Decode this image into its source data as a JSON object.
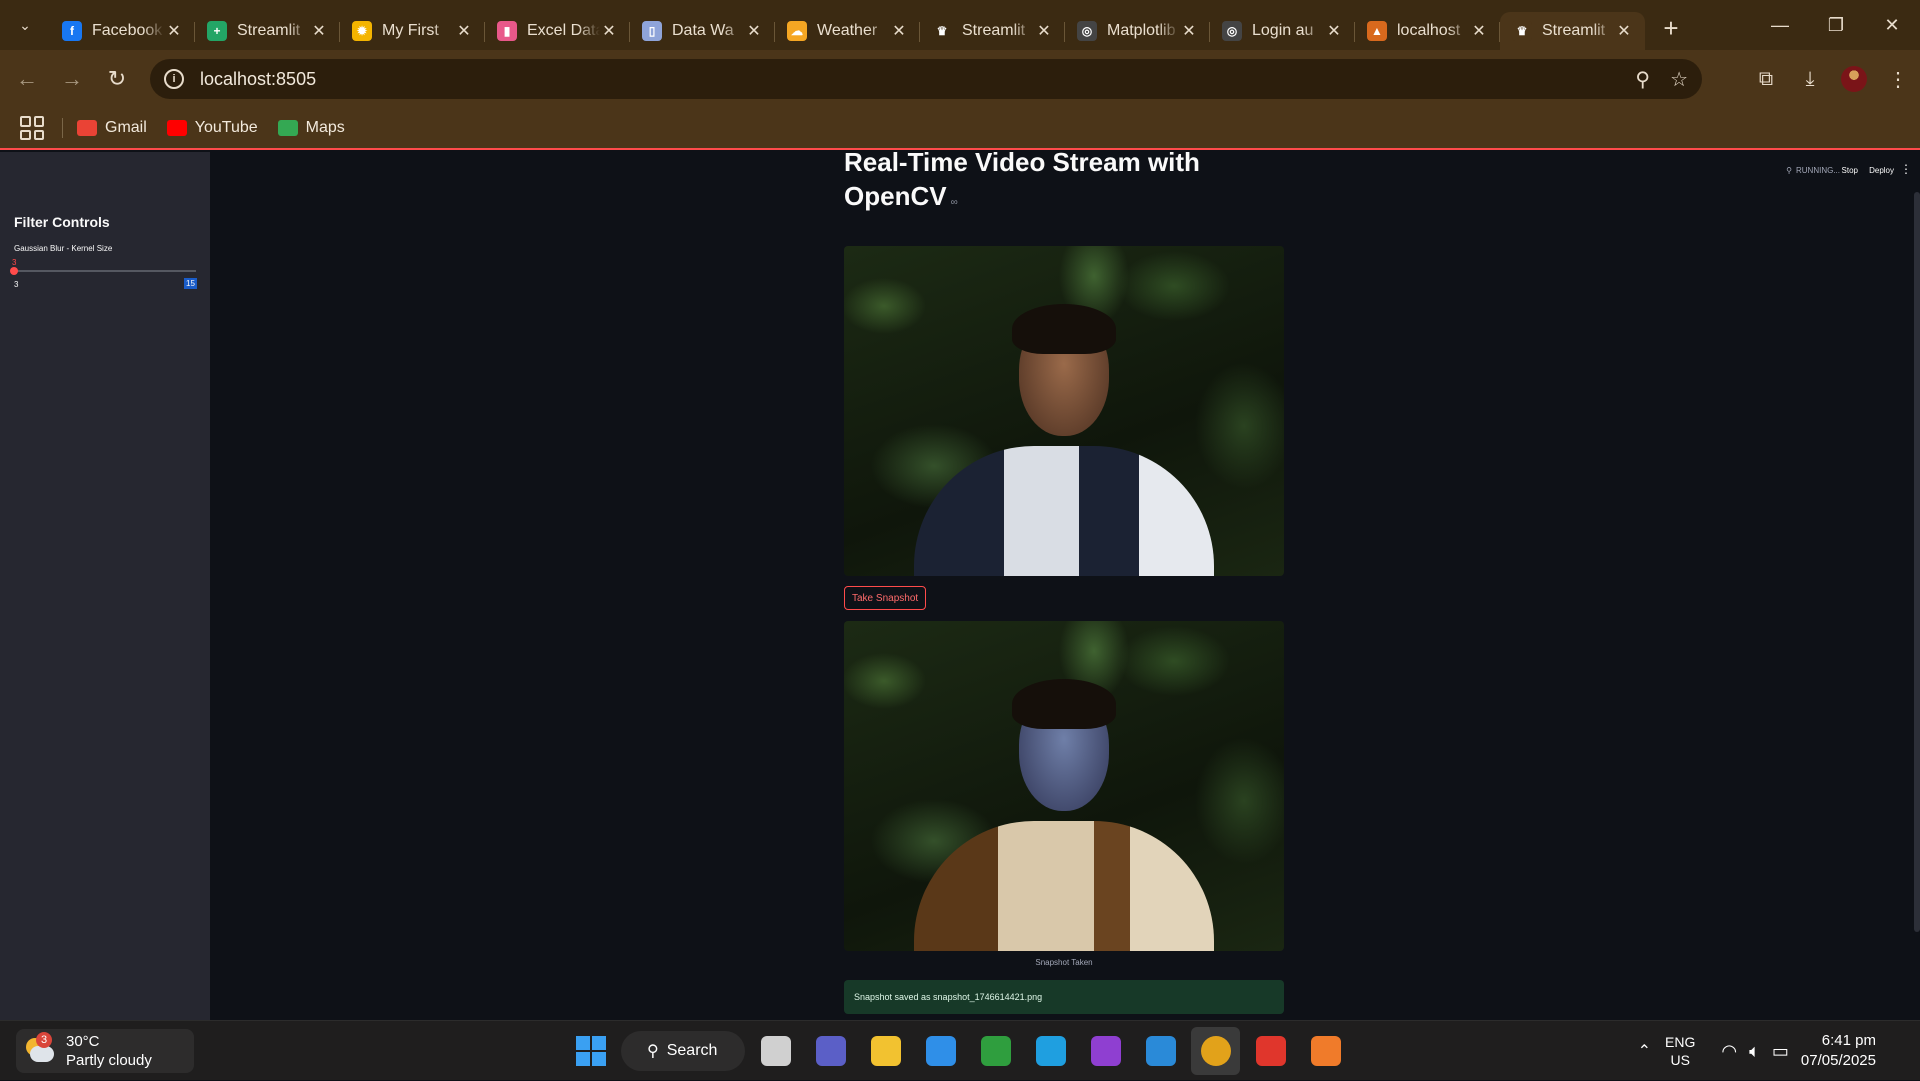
{
  "browser": {
    "tabs": [
      {
        "title": "Facebook",
        "icon": "facebook-icon",
        "color": "#1877f2",
        "glyph": "f"
      },
      {
        "title": "Streamlit",
        "icon": "sheets-icon",
        "color": "#23a566",
        "glyph": "+"
      },
      {
        "title": "My First",
        "icon": "sun-icon",
        "color": "#f4b400",
        "glyph": "✹"
      },
      {
        "title": "Excel Data",
        "icon": "chart-icon",
        "color": "#e8588a",
        "glyph": "▮"
      },
      {
        "title": "Data Wa",
        "icon": "building-icon",
        "color": "#8fa4d9",
        "glyph": "▯"
      },
      {
        "title": "Weather",
        "icon": "weather-icon",
        "color": "#f5a623",
        "glyph": "☁"
      },
      {
        "title": "Streamlit",
        "icon": "streamlit-icon",
        "color": "#3b2a12",
        "glyph": "♛"
      },
      {
        "title": "Matplotlib",
        "icon": "openai-icon",
        "color": "#444",
        "glyph": "◎"
      },
      {
        "title": "Login au",
        "icon": "openai-icon",
        "color": "#444",
        "glyph": "◎"
      },
      {
        "title": "localhost",
        "icon": "xampp-icon",
        "color": "#d8691d",
        "glyph": "▲"
      },
      {
        "title": "Streamlit",
        "icon": "streamlit-icon",
        "color": "#4b3519",
        "glyph": "♛",
        "active": true
      }
    ],
    "url": "localhost:8505",
    "bookmarks": [
      {
        "label": "Gmail",
        "icon": "gmail-icon",
        "color": "#ea4335"
      },
      {
        "label": "YouTube",
        "icon": "youtube-icon",
        "color": "#ff0000"
      },
      {
        "label": "Maps",
        "icon": "maps-icon",
        "color": "#34a853"
      }
    ]
  },
  "app": {
    "status": "RUNNING...",
    "stop_label": "Stop",
    "deploy_label": "Deploy",
    "title_line1": "Real-Time Video Stream with",
    "title_line2": "OpenCV",
    "snapshot_button": "Take Snapshot",
    "caption": "Snapshot Taken",
    "success_message": "Snapshot saved as snapshot_1746614421.png"
  },
  "sidebar": {
    "title": "Filter Controls",
    "slider": {
      "label": "Gaussian Blur - Kernel Size",
      "value": 3,
      "min": 3,
      "max": 15
    }
  },
  "taskbar": {
    "weather_temp": "30°C",
    "weather_desc": "Partly cloudy",
    "weather_badge": "3",
    "search_label": "Search",
    "lang_top": "ENG",
    "lang_bottom": "US",
    "time": "6:41 pm",
    "date": "07/05/2025",
    "apps": [
      {
        "name": "task-view-icon",
        "color": "#d0d0d0"
      },
      {
        "name": "teams-icon",
        "color": "#5b5fc7"
      },
      {
        "name": "file-explorer-icon",
        "color": "#f2c230"
      },
      {
        "name": "store-icon",
        "color": "#2f8fe8"
      },
      {
        "name": "xbox-icon",
        "color": "#2f9e3e"
      },
      {
        "name": "edge-icon",
        "color": "#1f9fe0"
      },
      {
        "name": "vpn-icon",
        "color": "#8f3fd1"
      },
      {
        "name": "vscode-icon",
        "color": "#2a8ad8"
      },
      {
        "name": "chrome-icon",
        "color": "#e2a21a",
        "active": true
      },
      {
        "name": "wps-icon",
        "color": "#e0362c"
      },
      {
        "name": "xampp-icon",
        "color": "#f07b2a"
      }
    ]
  }
}
